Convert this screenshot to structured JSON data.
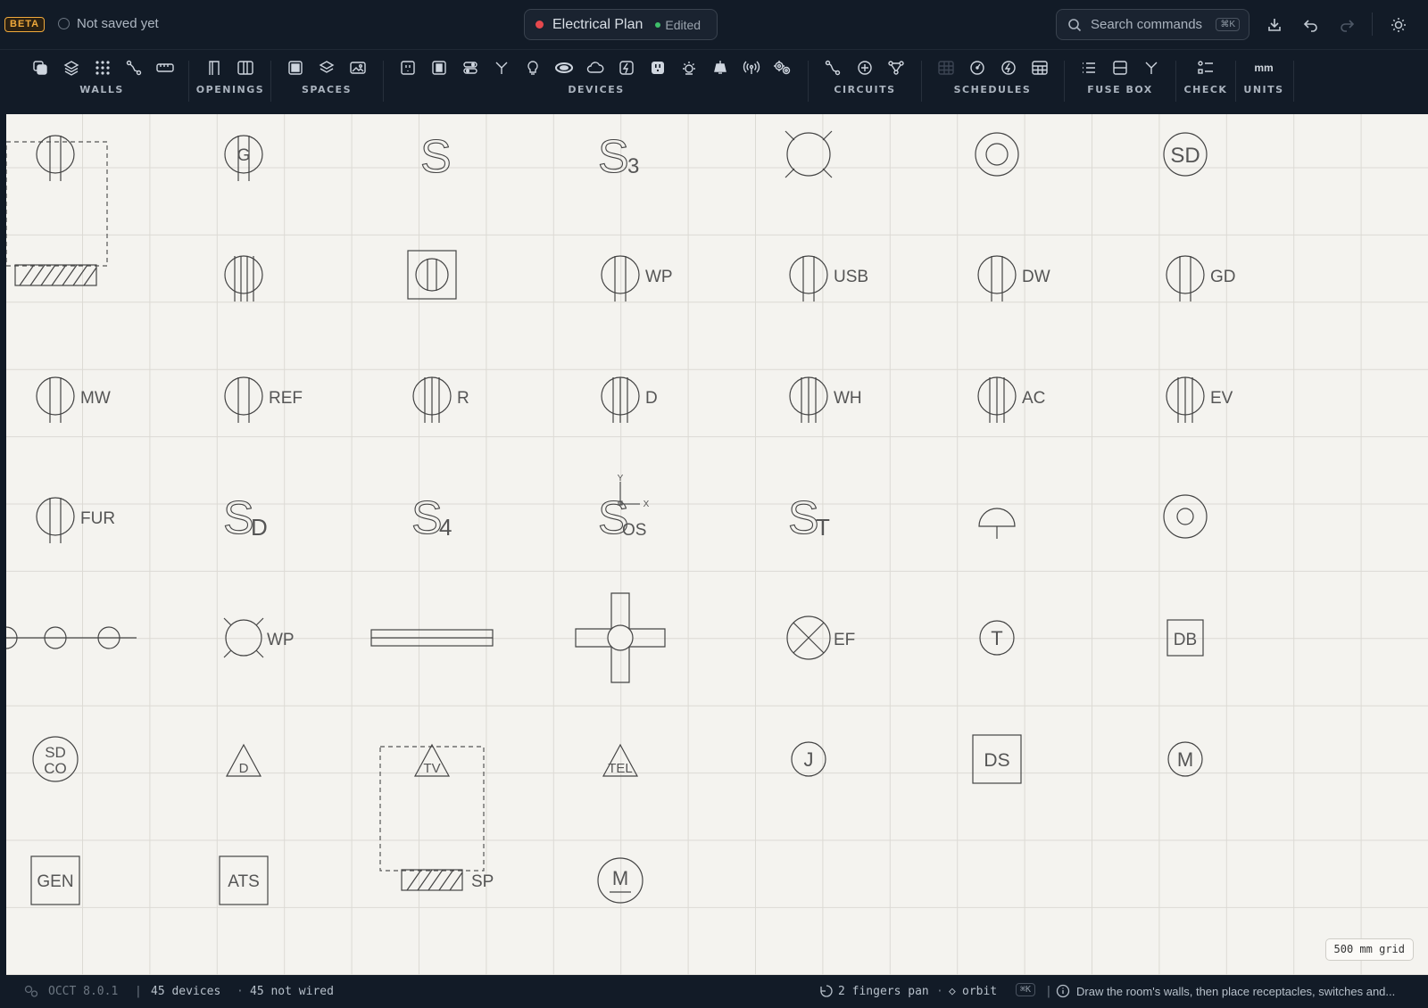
{
  "topbar": {
    "beta_label": "BETA",
    "save_status": "Not saved yet",
    "document_title": "Electrical Plan",
    "edited_label": "Edited",
    "search_placeholder": "Search commands",
    "search_shortcut": "⌘K"
  },
  "toolbar": {
    "groups": [
      {
        "label": "WALLS",
        "icons": [
          "copy-icon",
          "layers-icon",
          "grid-dots-icon",
          "route-icon",
          "ruler-icon"
        ]
      },
      {
        "label": "OPENINGS",
        "icons": [
          "door-icon",
          "window-icon"
        ]
      },
      {
        "label": "SPACES",
        "icons": [
          "room-icon",
          "stack-icon",
          "image-icon"
        ]
      },
      {
        "label": "DEVICES",
        "icons": [
          "receptacle-icon",
          "switch-icon",
          "dimmer-icon",
          "split-icon",
          "bulb-icon",
          "ceiling-light-icon",
          "cloud-icon",
          "power-icon",
          "outlet-icon",
          "sun-icon",
          "pendant-icon",
          "antenna-icon",
          "gears-icon"
        ]
      },
      {
        "label": "CIRCUITS",
        "icons": [
          "wire-icon",
          "add-circle-icon",
          "network-icon"
        ]
      },
      {
        "label": "SCHEDULES",
        "icons": [
          "table-disabled-icon",
          "gauge-icon",
          "bolt-icon",
          "table-icon"
        ]
      },
      {
        "label": "FUSE BOX",
        "icons": [
          "list-icon",
          "panel-icon",
          "branch-icon"
        ]
      },
      {
        "label": "CHECK",
        "icons": [
          "checklist-icon"
        ]
      },
      {
        "label": "UNITS",
        "icons": [
          "mm-text"
        ],
        "unit_text": "mm"
      }
    ]
  },
  "canvas": {
    "grid_label": "500 mm grid",
    "symbol_labels": {
      "ground": "G",
      "switch": "S",
      "switch3": "3",
      "smoke": "SD",
      "wp": "WP",
      "usb": "USB",
      "dw": "DW",
      "gd": "GD",
      "mw": "MW",
      "ref": "REF",
      "r": "R",
      "d": "D",
      "wh": "WH",
      "ac": "AC",
      "ev": "EV",
      "fur": "FUR",
      "s4": "4",
      "axis_y": "Y",
      "axis_x": "X",
      "os": "OS",
      "t_sub": "T",
      "ef": "EF",
      "t": "T",
      "db": "DB",
      "sd": "SD",
      "co": "CO",
      "tv": "TV",
      "tel": "TEL",
      "j": "J",
      "ds": "DS",
      "m": "M",
      "gen": "GEN",
      "ats": "ATS",
      "sp": "SP"
    }
  },
  "statusbar": {
    "kernel": "OCCT 8.0.1",
    "device_count": "45 devices",
    "wired_status": "45 not wired",
    "pan_hint": "2 fingers pan",
    "orbit_hint": "orbit",
    "shortcut": "⌘K",
    "help_text": "Draw the room's walls, then place receptacles, switches and..."
  },
  "colors": {
    "background": "#111a26",
    "canvas": "#f4f3ef",
    "accent_beta": "#f0a93b",
    "unsaved_dot": "#e5484d",
    "edited_dot": "#3fbf6a"
  }
}
